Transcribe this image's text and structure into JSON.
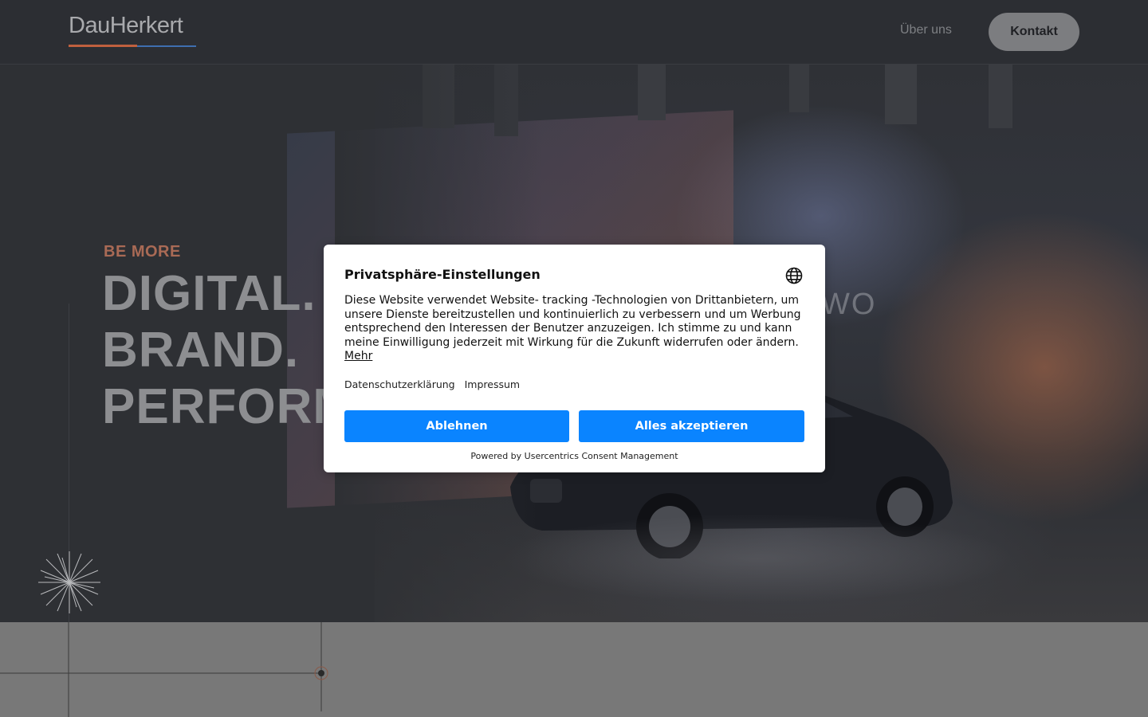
{
  "header": {
    "logo_text": "DauHerkert",
    "logo_colors": [
      "#c0603e",
      "#3f6fb0"
    ],
    "nav": [
      {
        "label": "Über uns"
      }
    ],
    "cta_label": "Kontakt"
  },
  "hero": {
    "kicker": "BE MORE",
    "title_lines": [
      "DIGITAL.",
      "BRAND.",
      "PERFORMANCE."
    ],
    "background_mark": "WO"
  },
  "consent": {
    "title": "Privatsphäre-Einstellungen",
    "language_icon": "globe-icon",
    "body": "Diese Website verwendet Website- tracking -Technologien von Drittanbietern, um unsere Dienste bereitzustellen und kontinuierlich zu verbessern und um Werbung entsprechend den Interessen der Benutzer anzuzeigen. Ich stimme zu und kann meine Einwilligung jederzeit mit Wirkung für die Zukunft widerrufen oder ändern.",
    "more_label": "Mehr",
    "links": [
      {
        "label": "Datenschutzerklärung"
      },
      {
        "label": "Impressum"
      }
    ],
    "deny_label": "Ablehnen",
    "accept_label": "Alles akzeptieren",
    "powered_by": "Powered by Usercentrics Consent Management",
    "button_color": "#0a84ff"
  }
}
